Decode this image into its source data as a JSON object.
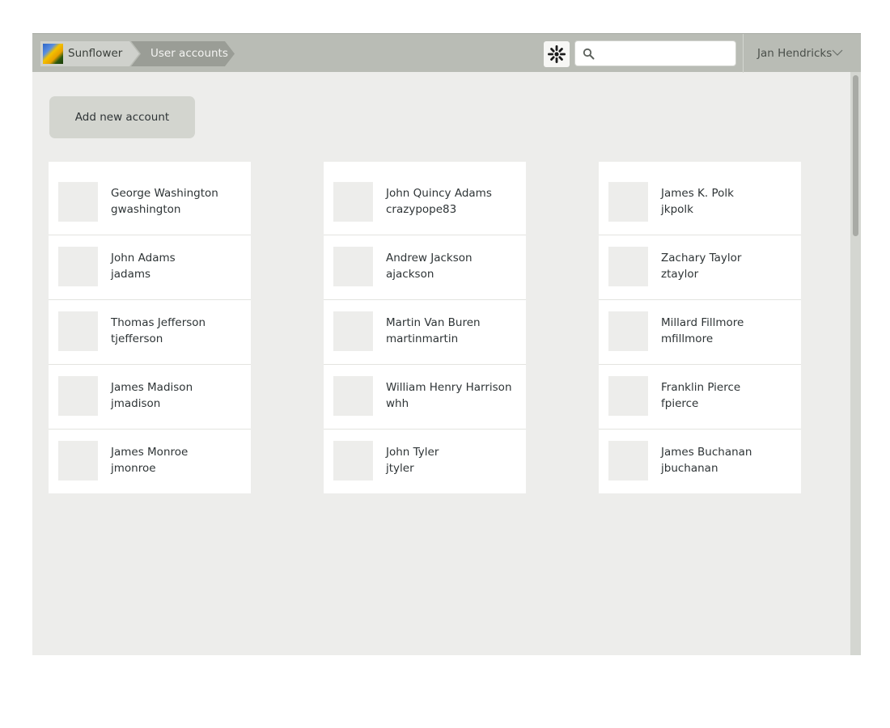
{
  "header": {
    "breadcrumb_root": "Sunflower",
    "breadcrumb_current": "User accounts",
    "search_placeholder": "",
    "user_name": "Jan Hendricks"
  },
  "main": {
    "add_button_label": "Add new account",
    "columns": [
      [
        {
          "name": "George Washington",
          "username": "gwashington"
        },
        {
          "name": "John Adams",
          "username": "jadams"
        },
        {
          "name": "Thomas Jefferson",
          "username": "tjefferson"
        },
        {
          "name": "James Madison",
          "username": "jmadison"
        },
        {
          "name": "James Monroe",
          "username": "jmonroe"
        }
      ],
      [
        {
          "name": "John Quincy Adams",
          "username": "crazypope83"
        },
        {
          "name": "Andrew Jackson",
          "username": "ajackson"
        },
        {
          "name": "Martin Van Buren",
          "username": "martinmartin"
        },
        {
          "name": "William Henry Harrison",
          "username": "whh"
        },
        {
          "name": "John Tyler",
          "username": "jtyler"
        }
      ],
      [
        {
          "name": "James K. Polk",
          "username": "jkpolk"
        },
        {
          "name": "Zachary Taylor",
          "username": "ztaylor"
        },
        {
          "name": "Millard Fillmore",
          "username": "mfillmore"
        },
        {
          "name": "Franklin Pierce",
          "username": "fpierce"
        },
        {
          "name": "James Buchanan",
          "username": "jbuchanan"
        }
      ]
    ]
  },
  "icons": {
    "logo": "sunflower-logo",
    "gear": "gear-icon",
    "search": "search-icon",
    "chevron": "chevron-down-icon"
  },
  "colors": {
    "header_bg": "#b9bcb5",
    "content_bg": "#ededeb",
    "card_bg": "#ffffff",
    "button_bg": "#d3d5cf"
  }
}
